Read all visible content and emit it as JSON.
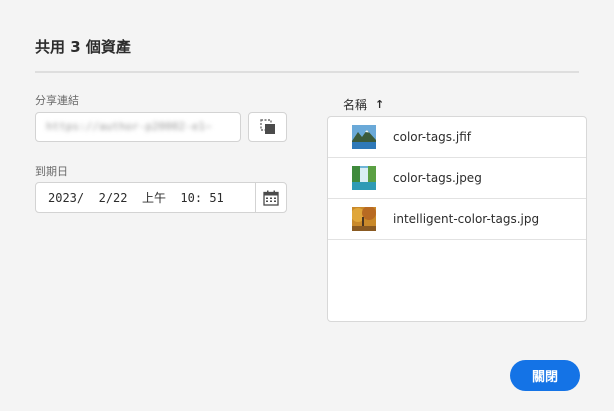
{
  "dialog": {
    "title": "共用 3 個資產",
    "link_label": "分享連結",
    "link_value": "https://author-p20002-e1~",
    "expiry_label": "到期日",
    "expiry": {
      "year": "2023",
      "month": " 2",
      "day": "22",
      "ampm": "上午",
      "hour": "10",
      "minute": "51"
    },
    "sort_header": "名稱",
    "sort_arrow": "↑",
    "files": [
      {
        "name": "color-tags.jfif",
        "thumb_icon": "mountain-lake-thumbnail"
      },
      {
        "name": "color-tags.jpeg",
        "thumb_icon": "waterfall-thumbnail"
      },
      {
        "name": "intelligent-color-tags.jpg",
        "thumb_icon": "autumn-trees-thumbnail"
      }
    ],
    "close_label": "關閉"
  },
  "colors": {
    "accent": "#1473e6",
    "background": "#f4f4f4"
  }
}
